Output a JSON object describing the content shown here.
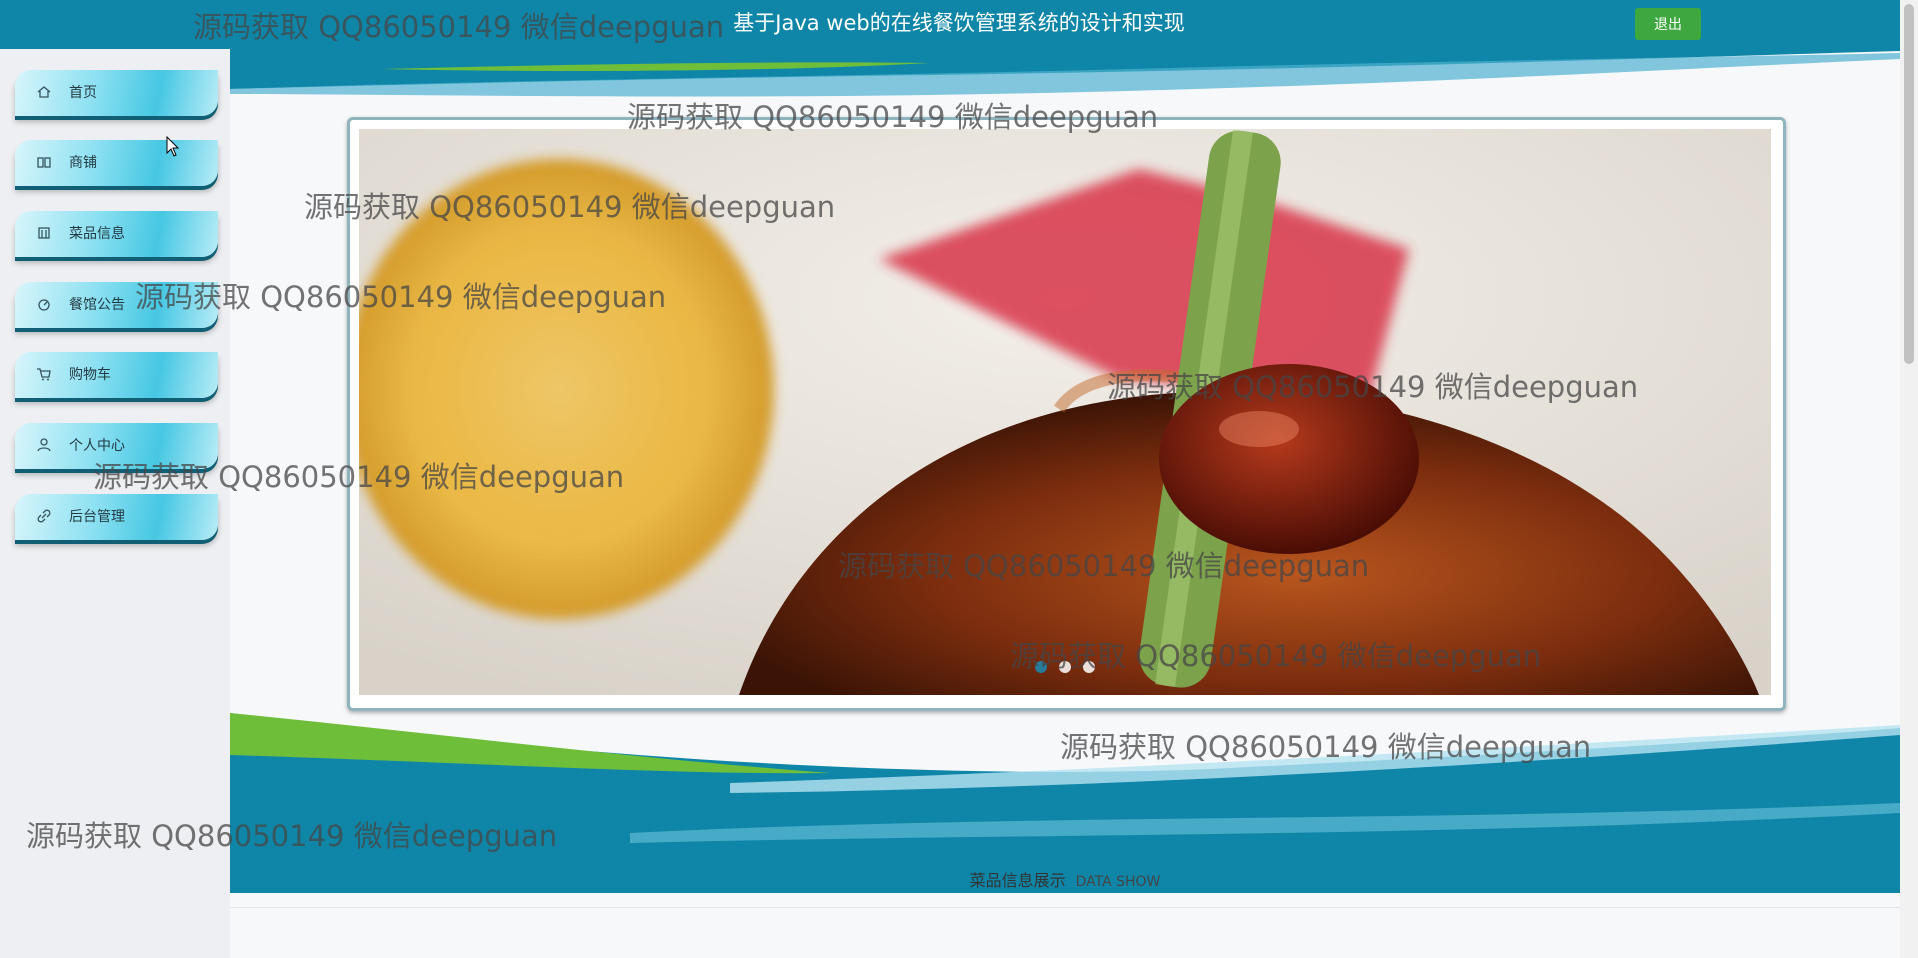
{
  "header": {
    "title": "基于Java web的在线餐饮管理系统的设计和实现",
    "logout_label": "退出"
  },
  "sidebar": {
    "items": [
      {
        "label": "首页",
        "icon": "home-icon"
      },
      {
        "label": "商铺",
        "icon": "store-icon"
      },
      {
        "label": "菜品信息",
        "icon": "dish-icon"
      },
      {
        "label": "餐馆公告",
        "icon": "notice-icon"
      },
      {
        "label": "购物车",
        "icon": "cart-icon"
      },
      {
        "label": "个人中心",
        "icon": "user-icon"
      },
      {
        "label": "后台管理",
        "icon": "link-icon"
      }
    ]
  },
  "banner": {
    "slides": 3,
    "active_slide": 1
  },
  "section": {
    "title": "菜品信息展示",
    "subtitle": "DATA SHOW"
  },
  "watermark": {
    "text": "源码获取 QQ86050149 微信deepguan"
  },
  "colors": {
    "header": "#0f86a8",
    "logout": "#3fa73f",
    "accent": "#1a8bb3"
  }
}
